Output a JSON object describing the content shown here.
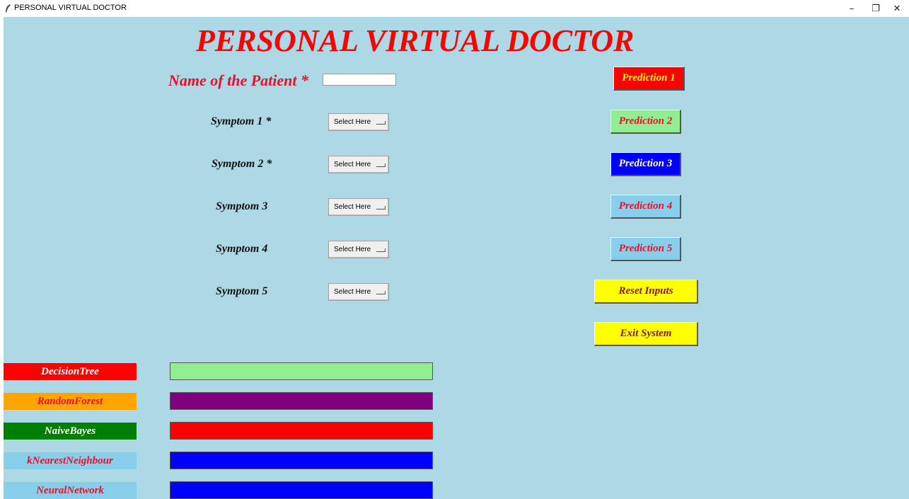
{
  "window": {
    "title": "PERSONAL VIRTUAL DOCTOR",
    "minimize_label": "–",
    "restore_label": "❐",
    "close_label": "✕"
  },
  "header": {
    "title": "PERSONAL VIRTUAL DOCTOR"
  },
  "patient": {
    "label": "Name of the Patient *",
    "value": ""
  },
  "symptoms": [
    {
      "label": "Symptom 1 *",
      "value": "Select Here"
    },
    {
      "label": "Symptom 2 *",
      "value": "Select Here"
    },
    {
      "label": "Symptom 3",
      "value": "Select Here"
    },
    {
      "label": "Symptom 4",
      "value": "Select Here"
    },
    {
      "label": "Symptom 5",
      "value": "Select Here"
    }
  ],
  "buttons": {
    "prediction_1": "Prediction 1",
    "prediction_2": "Prediction 2",
    "prediction_3": "Prediction 3",
    "prediction_4": "Prediction 4",
    "prediction_5": "Prediction 5",
    "reset": "Reset Inputs",
    "exit": "Exit System"
  },
  "algorithms": [
    {
      "label": "DecisionTree",
      "label_bg": "#ff0000",
      "label_fg": "#ffffff",
      "result": "",
      "result_bg": "#90ee90"
    },
    {
      "label": "RandomForest",
      "label_bg": "#ffa500",
      "label_fg": "#e8102b",
      "result": "",
      "result_bg": "#800080"
    },
    {
      "label": "NaiveBayes",
      "label_bg": "#008000",
      "label_fg": "#ffffff",
      "result": "",
      "result_bg": "#ff0000"
    },
    {
      "label": "kNearestNeighbour",
      "label_bg": "#87ceeb",
      "label_fg": "#e8102b",
      "result": "",
      "result_bg": "#0000ff"
    },
    {
      "label": "NeuralNetwork",
      "label_bg": "#87ceeb",
      "label_fg": "#e8102b",
      "result": "",
      "result_bg": "#0000ff"
    }
  ],
  "colors": {
    "background": "#add8e6",
    "title": "#ff0000"
  }
}
